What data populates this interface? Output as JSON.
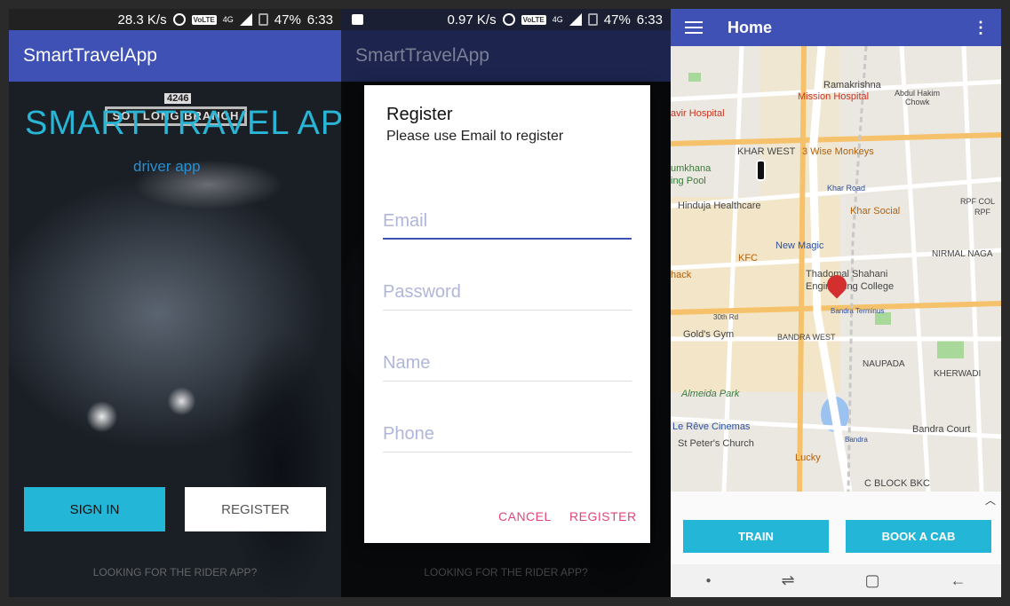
{
  "screen1": {
    "status": {
      "speed": "28.3 K/s",
      "network": "4G",
      "lte": "VoLTE",
      "battery": "47%",
      "time": "6:33"
    },
    "app_title": "SmartTravelApp",
    "heading": "SMART TRAVEL APP",
    "subheading": "driver app",
    "bus_sign": "SOT LONG BRANCH",
    "bus_number": "4246",
    "sign_in_label": "SIGN IN",
    "register_label": "REGISTER",
    "footer_text": "LOOKING FOR THE RIDER APP?"
  },
  "screen2": {
    "status": {
      "speed": "0.97 K/s",
      "network": "4G",
      "lte": "VoLTE",
      "battery": "47%",
      "time": "6:33"
    },
    "app_title": "SmartTravelApp",
    "dialog": {
      "title": "Register",
      "subtitle": "Please use Email to register",
      "fields": {
        "email_placeholder": "Email",
        "password_placeholder": "Password",
        "name_placeholder": "Name",
        "phone_placeholder": "Phone"
      },
      "cancel_label": "CANCEL",
      "register_label": "REGISTER"
    },
    "footer_text": "LOOKING FOR THE RIDER APP?"
  },
  "screen3": {
    "title": "Home",
    "map_labels": {
      "ramakrishna": "Ramakrishna",
      "mission_hospital": "Mission Hospital",
      "abdul_hakim": "Abdul Hakim",
      "chowk": "Chowk",
      "avir_hospital": "avir Hospital",
      "khar_west": "KHAR WEST",
      "wise_monkeys": "3 Wise Monkeys",
      "umkhana": "umkhana",
      "ing_pool": "ing Pool",
      "khar_road": "Khar Road",
      "hinduja": "Hinduja Healthcare",
      "khar_social": "Khar Social",
      "rpf_col": "RPF COL",
      "rpf": "RPF",
      "new_magic": "New Magic",
      "kfc": "KFC",
      "nirmal_naga": "NIRMAL NAGA",
      "thadomal": "Thadomal Shahani",
      "engineering": "Engineering College",
      "hack": "hack",
      "bandra_terminus": "Bandra Terminus",
      "road_30th": "30th Rd",
      "golds_gym": "Gold's Gym",
      "bandra_west": "BANDRA WEST",
      "naupada": "NAUPADA",
      "kherwadi": "KHERWADI",
      "almeida_park": "Almeida Park",
      "le_reve": "Le Rêve Cinemas",
      "st_peters": "St Peter's Church",
      "bandra": "Bandra",
      "bandra_court": "Bandra Court",
      "lucky": "Lucky",
      "c_block": "C BLOCK BKC"
    },
    "train_label": "TRAIN",
    "book_cab_label": "BOOK A CAB"
  },
  "colors": {
    "primary": "#3f51b5",
    "accent": "#24b6d6",
    "dialog_action": "#e0457a"
  }
}
